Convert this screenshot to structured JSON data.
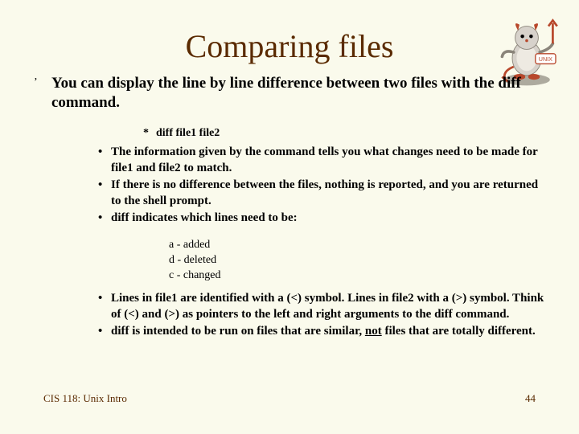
{
  "title": "Comparing files",
  "main_bullet": {
    "tick": "’",
    "text": "You can display the line by line difference between two files with the diff command."
  },
  "star_line": {
    "star": "*",
    "text": "diff file1 file2"
  },
  "sub1": {
    "a": "The information given by the command tells you what changes need to be made for file1 and file2 to match.",
    "b": "If there is no difference between the files, nothing is reported, and you are returned to the shell prompt.",
    "c": "diff indicates which lines need to be:"
  },
  "actions": {
    "a": "a -  added",
    "d": "d -  deleted",
    "c": "c -  changed"
  },
  "sub2": {
    "a_parts": {
      "p1": "Lines in file1 are identified with a (<) symbol.  Lines in file2 with a (>) symbol.  Think of (<) and (>) as pointers to the left and right arguments to the diff command."
    },
    "b_parts": {
      "p1": "diff is intended to be run on files that are similar, ",
      "p2": "not",
      "p3": " files that are totally different."
    }
  },
  "footer": {
    "left": "CIS 118: Unix Intro",
    "right": "44"
  },
  "bullet_dot": "•"
}
